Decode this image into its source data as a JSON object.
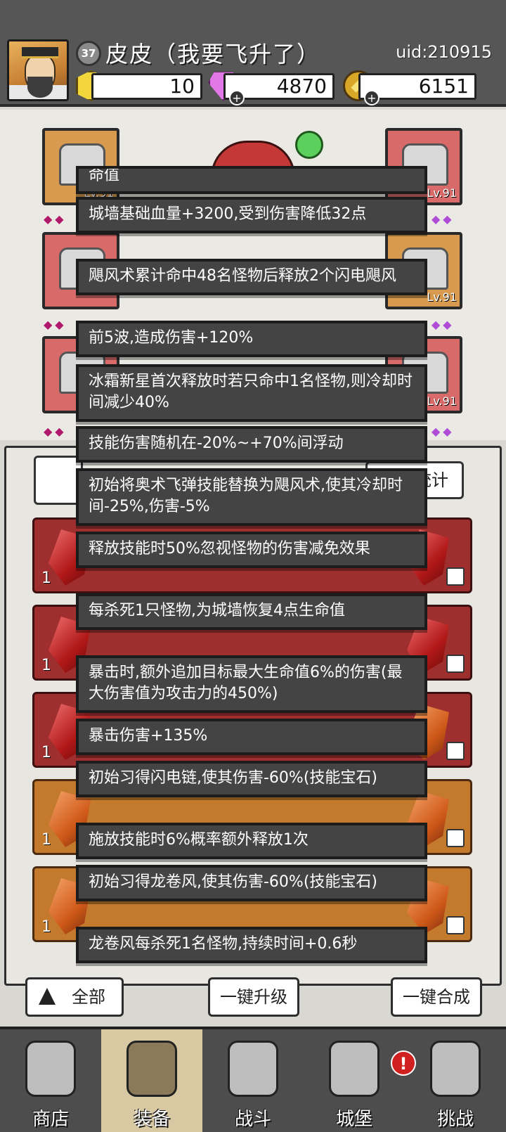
{
  "header": {
    "level": "37",
    "player_name": "皮皮（我要飞升了）",
    "uid": "uid:210915",
    "currencies": [
      {
        "icon": "gold-hexagon-icon",
        "value": "10",
        "has_plus": false
      },
      {
        "icon": "purple-diamond-icon",
        "value": "4870",
        "has_plus": true
      },
      {
        "icon": "gold-coin-icon",
        "value": "6151",
        "has_plus": true
      }
    ]
  },
  "equipment": {
    "slot_level_label": "Lv.91"
  },
  "panel": {
    "stat_button": "属性统计",
    "row_counts": [
      "1",
      "1",
      "1",
      "1",
      "1"
    ]
  },
  "tooltip": {
    "cut_top": "命值",
    "effects": [
      "城墙基础血量+3200,受到伤害降低32点",
      "飓风术累计命中48名怪物后释放2个闪电飓风",
      "前5波,造成伤害+120%",
      "冰霜新星首次释放时若只命中1名怪物,则冷却时间减少40%",
      "技能伤害随机在-20%~+70%间浮动",
      "初始将奥术飞弹技能替换为飓风术,使其冷却时间-25%,伤害-5%",
      "释放技能时50%忽视怪物的伤害减免效果",
      "每杀死1只怪物,为城墙恢复4点生命值",
      "暴击时,额外追加目标最大生命值6%的伤害(最大伤害值为攻击力的450%)",
      "暴击伤害+135%",
      "初始习得闪电链,使其伤害-60%(技能宝石)",
      "施放技能时6%概率额外释放1次",
      "初始习得龙卷风,使其伤害-60%(技能宝石)",
      "龙卷风每杀死1名怪物,持续时间+0.6秒"
    ]
  },
  "actions": {
    "filter": "全部",
    "upgrade": "一键升级",
    "merge": "一键合成"
  },
  "nav": {
    "items": [
      {
        "label": "商店",
        "icon": "shop-icon"
      },
      {
        "label": "装备",
        "icon": "backpack-icon",
        "active": true
      },
      {
        "label": "战斗",
        "icon": "crossed-swords-icon"
      },
      {
        "label": "城堡",
        "icon": "castle-icon",
        "alert": "!"
      },
      {
        "label": "挑战",
        "icon": "shield-icon"
      }
    ]
  }
}
